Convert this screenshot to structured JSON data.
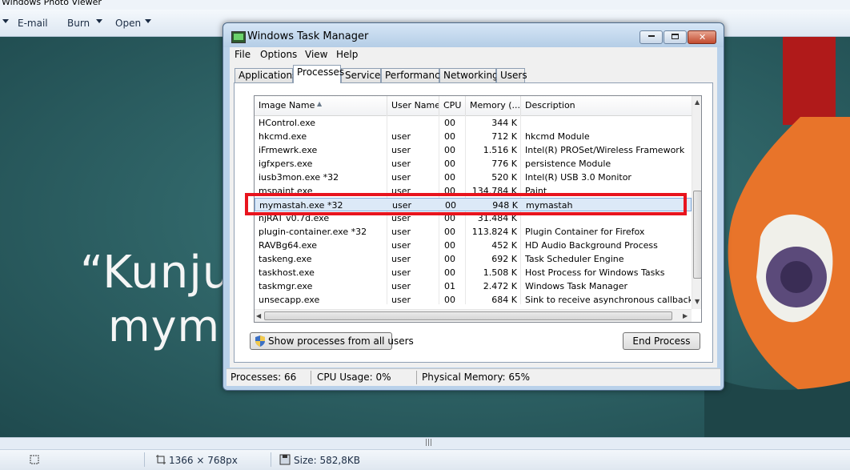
{
  "photo_viewer": {
    "title": "Windows Photo Viewer",
    "toolbar": {
      "email": "E-mail",
      "burn": "Burn",
      "open": "Open"
    },
    "photo_text_line1": "“Kunju",
    "photo_text_line2": "mym",
    "status": {
      "dimensions": "1366 × 768px",
      "size": "Size: 582,8KB"
    }
  },
  "task_manager": {
    "title": "Windows Task Manager",
    "menu": [
      "File",
      "Options",
      "View",
      "Help"
    ],
    "tabs": [
      "Applications",
      "Processes",
      "Services",
      "Performance",
      "Networking",
      "Users"
    ],
    "active_tab": "Processes",
    "columns": [
      "Image Name",
      "User Name",
      "CPU",
      "Memory (...",
      "Description"
    ],
    "processes": [
      {
        "name": "HControl.exe",
        "user": "",
        "cpu": "00",
        "memory": "344 K",
        "description": ""
      },
      {
        "name": "hkcmd.exe",
        "user": "user",
        "cpu": "00",
        "memory": "712 K",
        "description": "hkcmd Module"
      },
      {
        "name": "iFrmewrk.exe",
        "user": "user",
        "cpu": "00",
        "memory": "1.516 K",
        "description": "Intel(R) PROSet/Wireless Framework"
      },
      {
        "name": "igfxpers.exe",
        "user": "user",
        "cpu": "00",
        "memory": "776 K",
        "description": "persistence Module"
      },
      {
        "name": "iusb3mon.exe *32",
        "user": "user",
        "cpu": "00",
        "memory": "520 K",
        "description": "Intel(R) USB 3.0 Monitor"
      },
      {
        "name": "mspaint.exe",
        "user": "user",
        "cpu": "00",
        "memory": "134.784 K",
        "description": "Paint"
      },
      {
        "name": "mymastah.exe *32",
        "user": "user",
        "cpu": "00",
        "memory": "948 K",
        "description": "mymastah"
      },
      {
        "name": "njRAT v0.7d.exe",
        "user": "user",
        "cpu": "00",
        "memory": "31.484 K",
        "description": ""
      },
      {
        "name": "plugin-container.exe *32",
        "user": "user",
        "cpu": "00",
        "memory": "113.824 K",
        "description": "Plugin Container for Firefox"
      },
      {
        "name": "RAVBg64.exe",
        "user": "user",
        "cpu": "00",
        "memory": "452 K",
        "description": "HD Audio Background Process"
      },
      {
        "name": "taskeng.exe",
        "user": "user",
        "cpu": "00",
        "memory": "692 K",
        "description": "Task Scheduler Engine"
      },
      {
        "name": "taskhost.exe",
        "user": "user",
        "cpu": "00",
        "memory": "1.508 K",
        "description": "Host Process for Windows Tasks"
      },
      {
        "name": "taskmgr.exe",
        "user": "user",
        "cpu": "01",
        "memory": "2.472 K",
        "description": "Windows Task Manager"
      },
      {
        "name": "unsecapp.exe",
        "user": "user",
        "cpu": "00",
        "memory": "684 K",
        "description": "Sink to receive asynchronous callbacks for ."
      }
    ],
    "selected_process": "mymastah.exe *32",
    "show_all_button": "Show processes from all users",
    "end_process_button": "End Process",
    "status": {
      "processes": "Processes: 66",
      "cpu": "CPU Usage: 0%",
      "memory": "Physical Memory: 65%"
    }
  },
  "colors": {
    "highlight_box": "#e8141e",
    "selection": "#dce9f7"
  }
}
